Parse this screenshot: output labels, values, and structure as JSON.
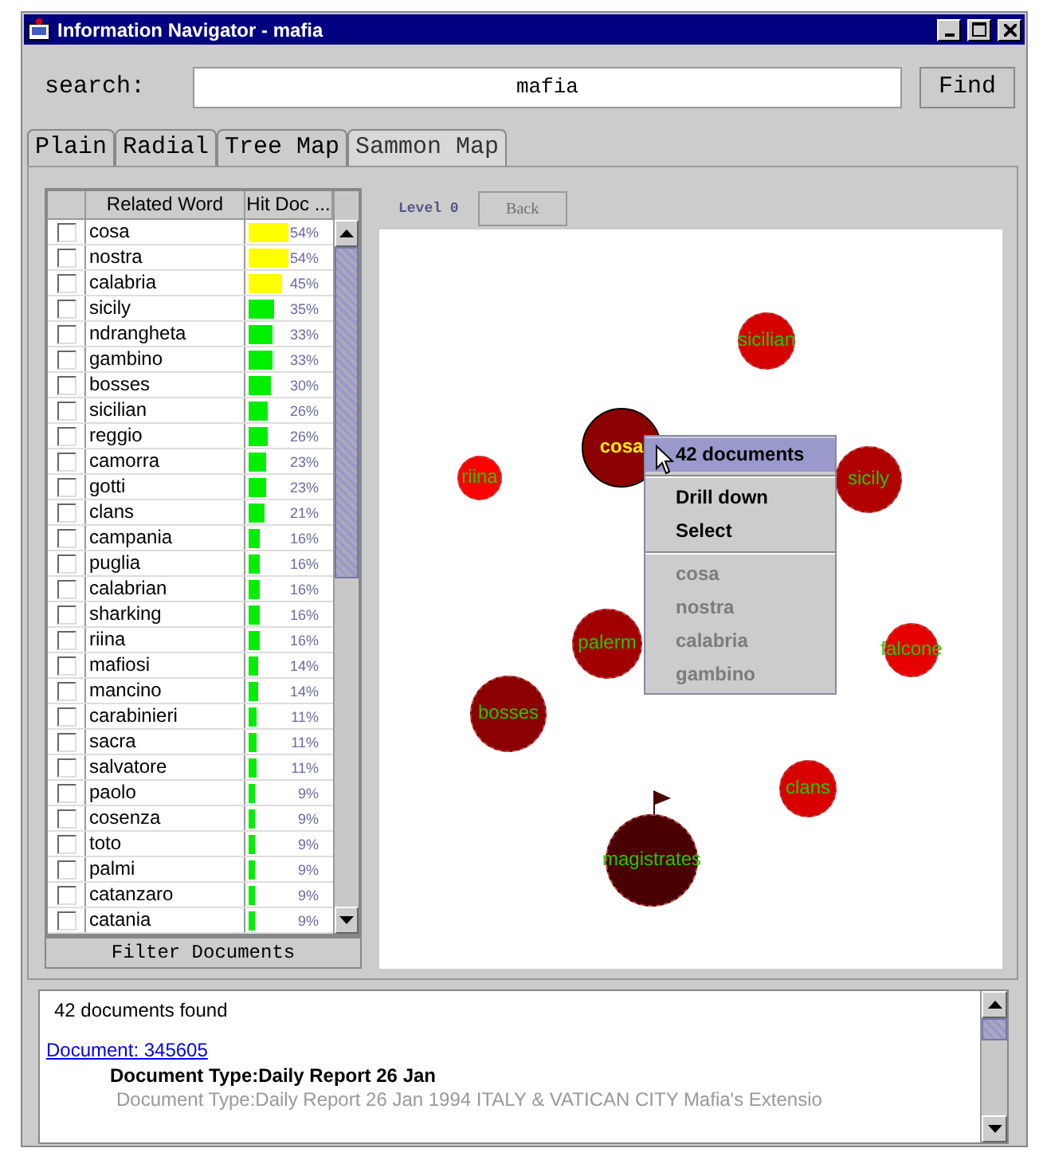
{
  "window": {
    "title": "Information Navigator - mafia"
  },
  "search": {
    "label": "search:",
    "value": "mafia",
    "button": "Find"
  },
  "tabs": [
    {
      "label": "Plain",
      "selected": false
    },
    {
      "label": "Radial",
      "selected": false
    },
    {
      "label": "Tree Map",
      "selected": false
    },
    {
      "label": "Sammon Map",
      "selected": true
    }
  ],
  "table": {
    "columns": [
      "Related Word",
      "Hit Doc ..."
    ],
    "rows": [
      {
        "word": "cosa",
        "hit": "54%",
        "color": "#ffff00",
        "checked": false
      },
      {
        "word": "nostra",
        "hit": "54%",
        "color": "#ffff00",
        "checked": false
      },
      {
        "word": "calabria",
        "hit": "45%",
        "color": "#ffff00",
        "checked": false
      },
      {
        "word": "sicily",
        "hit": "35%",
        "color": "#00ee00",
        "checked": false
      },
      {
        "word": "ndrangheta",
        "hit": "33%",
        "color": "#00ee00",
        "checked": false
      },
      {
        "word": "gambino",
        "hit": "33%",
        "color": "#00ee00",
        "checked": false
      },
      {
        "word": "bosses",
        "hit": "30%",
        "color": "#00ee00",
        "checked": false
      },
      {
        "word": "sicilian",
        "hit": "26%",
        "color": "#00ee00",
        "checked": false
      },
      {
        "word": "reggio",
        "hit": "26%",
        "color": "#00ee00",
        "checked": false
      },
      {
        "word": "camorra",
        "hit": "23%",
        "color": "#00ee00",
        "checked": false
      },
      {
        "word": "gotti",
        "hit": "23%",
        "color": "#00ee00",
        "checked": false
      },
      {
        "word": "clans",
        "hit": "21%",
        "color": "#00ee00",
        "checked": false
      },
      {
        "word": "campania",
        "hit": "16%",
        "color": "#00ee00",
        "checked": false
      },
      {
        "word": "puglia",
        "hit": "16%",
        "color": "#00ee00",
        "checked": false
      },
      {
        "word": "calabrian",
        "hit": "16%",
        "color": "#00ee00",
        "checked": false
      },
      {
        "word": "sharking",
        "hit": "16%",
        "color": "#00ee00",
        "checked": false
      },
      {
        "word": "riina",
        "hit": "16%",
        "color": "#00ee00",
        "checked": false
      },
      {
        "word": "mafiosi",
        "hit": "14%",
        "color": "#00ee00",
        "checked": false
      },
      {
        "word": "mancino",
        "hit": "14%",
        "color": "#00ee00",
        "checked": false
      },
      {
        "word": "carabinieri",
        "hit": "11%",
        "color": "#00ee00",
        "checked": false
      },
      {
        "word": "sacra",
        "hit": "11%",
        "color": "#00ee00",
        "checked": false
      },
      {
        "word": "salvatore",
        "hit": "11%",
        "color": "#00ee00",
        "checked": false
      },
      {
        "word": "paolo",
        "hit": "9%",
        "color": "#00ee00",
        "checked": false
      },
      {
        "word": "cosenza",
        "hit": "9%",
        "color": "#00ee00",
        "checked": false
      },
      {
        "word": "toto",
        "hit": "9%",
        "color": "#00ee00",
        "checked": false
      },
      {
        "word": "palmi",
        "hit": "9%",
        "color": "#00ee00",
        "checked": false
      },
      {
        "word": "catanzaro",
        "hit": "9%",
        "color": "#00ee00",
        "checked": false
      },
      {
        "word": "catania",
        "hit": "9%",
        "color": "#00ee00",
        "checked": false
      }
    ]
  },
  "filter_button": "Filter Documents",
  "map": {
    "level_label": "Level 0",
    "back_button": {
      "label": "Back",
      "disabled": true
    },
    "nodes": [
      {
        "label": "sicilian",
        "color": "#d40000",
        "selected": false,
        "flag": false
      },
      {
        "label": "cosa",
        "color": "#8b0000",
        "selected": true,
        "flag": false
      },
      {
        "label": "riina",
        "color": "#ff0000",
        "selected": false,
        "flag": false
      },
      {
        "label": "sicily",
        "color": "#b00000",
        "selected": false,
        "flag": false
      },
      {
        "label": "palerm",
        "color": "#a00000",
        "selected": false,
        "flag": false
      },
      {
        "label": "falcone",
        "color": "#e60000",
        "selected": false,
        "flag": false
      },
      {
        "label": "bosses",
        "color": "#8b0000",
        "selected": false,
        "flag": false
      },
      {
        "label": "clans",
        "color": "#d80000",
        "selected": false,
        "flag": false
      },
      {
        "label": "magistrates",
        "color": "#4a0000",
        "selected": false,
        "flag": true
      }
    ],
    "menu": {
      "groups": [
        [
          {
            "label": "42 documents",
            "highlighted": true,
            "disabled": false
          }
        ],
        [
          {
            "label": "Drill down",
            "highlighted": false,
            "disabled": false
          },
          {
            "label": "Select",
            "highlighted": false,
            "disabled": false
          }
        ],
        [
          {
            "label": "cosa",
            "highlighted": false,
            "disabled": true
          },
          {
            "label": "nostra",
            "highlighted": false,
            "disabled": true
          },
          {
            "label": "calabria",
            "highlighted": false,
            "disabled": true
          },
          {
            "label": "gambino",
            "highlighted": false,
            "disabled": true
          }
        ]
      ]
    }
  },
  "results": {
    "summary": "42 documents found",
    "documents": [
      {
        "link": "Document: 345605",
        "title": "Document Type:Daily Report 26 Jan",
        "snippet": "Document Type:Daily Report 26 Jan 1994 ITALY & VATICAN CITY Mafia's Extensio"
      }
    ]
  }
}
